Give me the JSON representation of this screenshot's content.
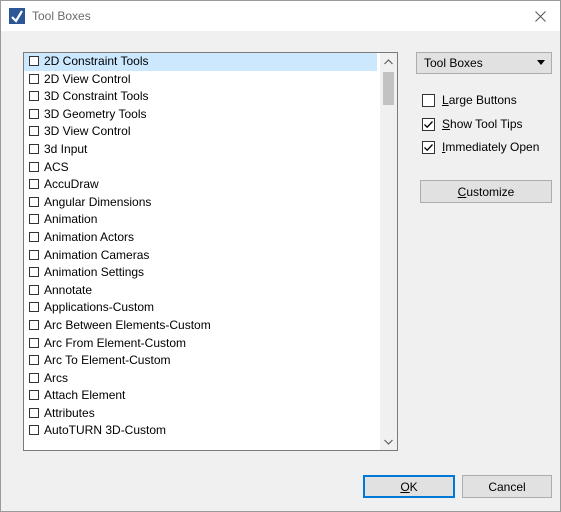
{
  "window": {
    "title": "Tool Boxes",
    "icon": "toolbox-app-icon",
    "close_icon": "close-icon"
  },
  "list": {
    "items": [
      "2D Constraint Tools",
      "2D View Control",
      "3D Constraint Tools",
      "3D Geometry Tools",
      "3D View Control",
      "3d Input",
      "ACS",
      "AccuDraw",
      "Angular Dimensions",
      "Animation",
      "Animation Actors",
      "Animation Cameras",
      "Animation Settings",
      "Annotate",
      "Applications-Custom",
      "Arc Between Elements-Custom",
      "Arc From Element-Custom",
      "Arc To Element-Custom",
      "Arcs",
      "Attach Element",
      "Attributes",
      "AutoTURN 3D-Custom"
    ],
    "selected_index": 0
  },
  "dropdown": {
    "value": "Tool Boxes",
    "icon": "chevron-down-icon"
  },
  "options": {
    "large_buttons": {
      "mnemonic": "L",
      "rest": "arge Buttons",
      "checked": false
    },
    "show_tool_tips": {
      "mnemonic": "S",
      "rest": "how Tool Tips",
      "checked": true
    },
    "immediately_open": {
      "mnemonic": "I",
      "rest": "mmediately Open",
      "checked": true
    }
  },
  "buttons": {
    "customize": {
      "mnemonic": "C",
      "rest": "ustomize"
    },
    "ok": {
      "mnemonic": "O",
      "rest": "K"
    },
    "cancel": "Cancel"
  },
  "colors": {
    "selection": "#cce8ff",
    "default_button_border": "#0078d7"
  }
}
